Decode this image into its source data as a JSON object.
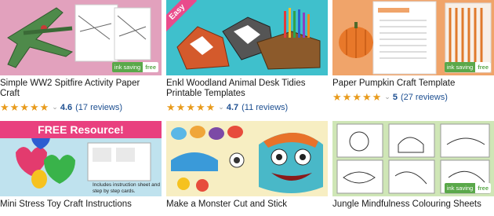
{
  "cards": [
    {
      "title": "Simple WW2 Spitfire Activity Paper Craft",
      "rating": "4.6",
      "reviews": "(17 reviews)",
      "stars_filled": 4.5,
      "badge": {
        "text": "ink saving",
        "label": "free"
      },
      "bg": "#e2a1bd"
    },
    {
      "title": "Enkl Woodland Animal Desk Tidies Printable Templates",
      "rating": "4.7",
      "reviews": "(11 reviews)",
      "stars_filled": 4.5,
      "ribbon": "Easy",
      "bg": "#3fc0cc"
    },
    {
      "title": "Paper Pumpkin Craft Template",
      "rating": "5",
      "reviews": "(27 reviews)",
      "stars_filled": 5,
      "badge": {
        "text": "ink saving",
        "label": "free"
      },
      "bg": "#f0a46a"
    },
    {
      "title": "Mini Stress Toy Craft Instructions",
      "banner": "FREE Resource!",
      "note": "Includes instruction sheet and step by step cards.",
      "bg": "#bfe2ee"
    },
    {
      "title": "Make a Monster Cut and Stick",
      "bg": "#f7eec2"
    },
    {
      "title": "Jungle Mindfulness Colouring Sheets",
      "badge": {
        "text": "ink saving",
        "label": "free"
      },
      "bg": "#cfe6b6"
    }
  ],
  "colors": {
    "star": "#e89b1c",
    "link": "#1d4f91",
    "badge_green": "#5aa84a",
    "free_pink": "#e9407f"
  }
}
